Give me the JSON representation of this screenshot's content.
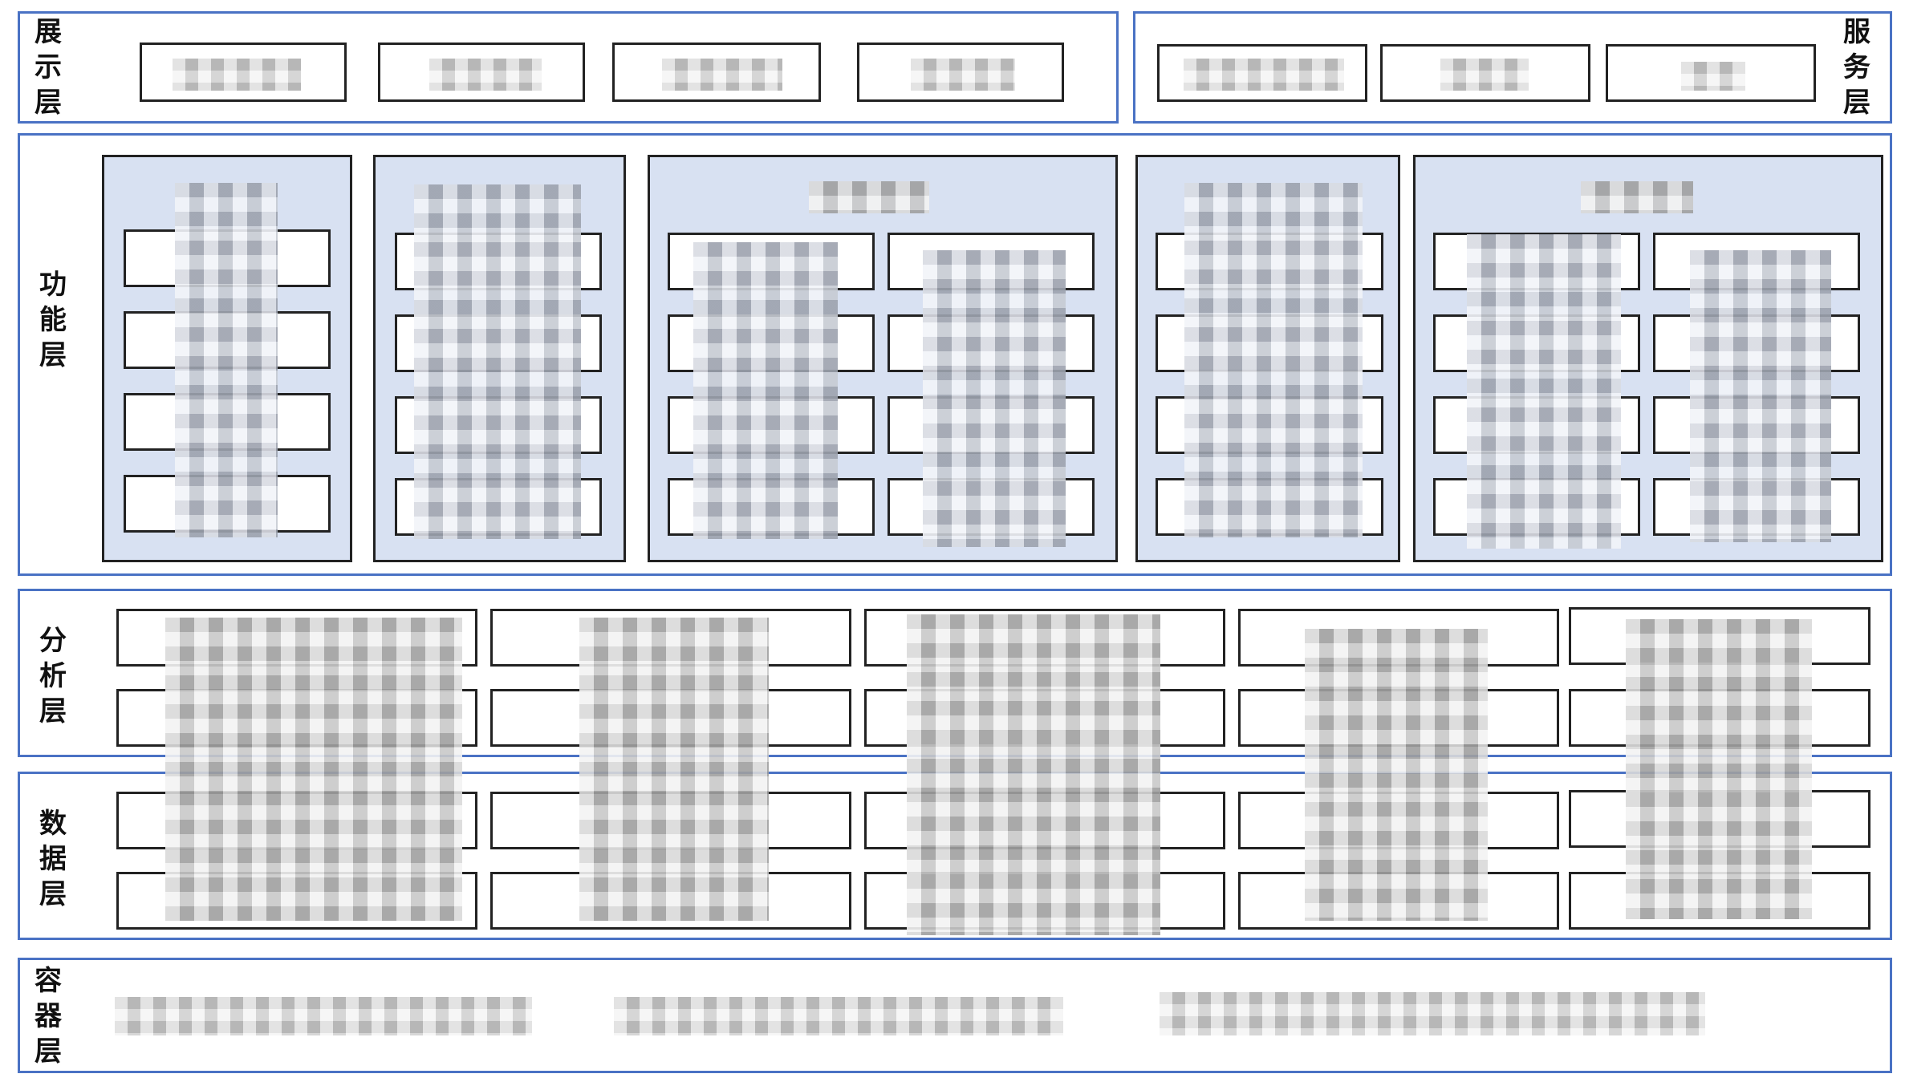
{
  "layers": {
    "presentation": {
      "label": [
        "展",
        "示",
        "层"
      ],
      "boxes": [
        "",
        "",
        "",
        ""
      ]
    },
    "service": {
      "label": [
        "服",
        "务",
        "层"
      ],
      "boxes": [
        "",
        "",
        ""
      ]
    },
    "function": {
      "label": [
        "功",
        "能",
        "层"
      ],
      "modules": [
        {
          "title": "",
          "items": [
            "",
            "",
            "",
            ""
          ]
        },
        {
          "title": "",
          "items": [
            "",
            "",
            "",
            ""
          ]
        },
        {
          "title": "",
          "items": [
            "",
            "",
            "",
            "",
            "",
            "",
            "",
            ""
          ]
        },
        {
          "title": "",
          "items": [
            "",
            "",
            "",
            ""
          ]
        },
        {
          "title": "",
          "items": [
            "",
            "",
            "",
            "",
            "",
            "",
            "",
            ""
          ]
        }
      ]
    },
    "analysis": {
      "label": [
        "分",
        "析",
        "层"
      ],
      "boxes": [
        "",
        "",
        "",
        "",
        "",
        "",
        "",
        "",
        "",
        ""
      ]
    },
    "data": {
      "label": [
        "数",
        "据",
        "层"
      ],
      "boxes": [
        "",
        "",
        "",
        "",
        "",
        "",
        "",
        "",
        "",
        ""
      ]
    },
    "container": {
      "label": [
        "容",
        "器",
        "层"
      ],
      "text": ""
    }
  }
}
